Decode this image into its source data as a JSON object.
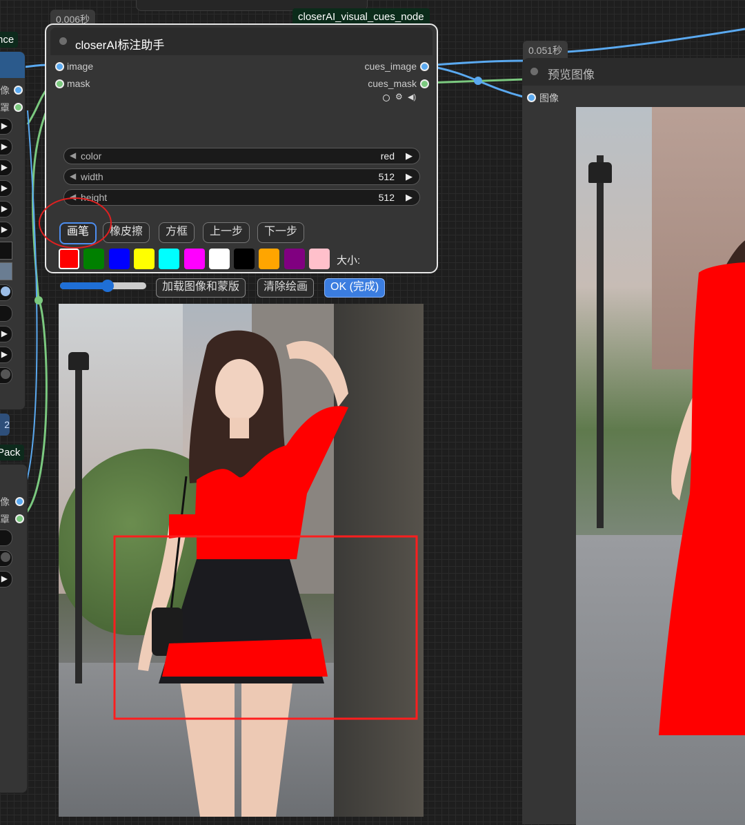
{
  "left_panel": {
    "top_node_title": "nce",
    "top_slots": [
      "像",
      "罩"
    ],
    "bottom_node_title": "Pack",
    "bottom_slots": [
      "像",
      "罩"
    ],
    "badge": "2"
  },
  "main_node": {
    "time": "0.006秒",
    "type_tag": "closerAI_visual_cues_node",
    "title": "closerAI标注助手",
    "inputs": [
      "image",
      "mask"
    ],
    "outputs": [
      "cues_image",
      "cues_mask"
    ],
    "widgets": [
      {
        "label": "color",
        "value": "red"
      },
      {
        "label": "width",
        "value": "512"
      },
      {
        "label": "height",
        "value": "512"
      }
    ],
    "tools": [
      "画笔",
      "橡皮擦",
      "方框",
      "上一步",
      "下一步"
    ],
    "active_tool": "画笔",
    "colors": [
      "#ff0000",
      "#008000",
      "#0000ff",
      "#ffff00",
      "#00ffff",
      "#ff00ff",
      "#ffffff",
      "#000000",
      "#ffa500",
      "#800080",
      "#ffc0cb"
    ],
    "selected_color": "#ff0000",
    "size_label": "大小:"
  },
  "canvas_controls": {
    "slider_value_fraction": 0.55,
    "load_button": "加载图像和蒙版",
    "clear_button": "清除绘画",
    "ok_button": "OK (完成)"
  },
  "preview_node": {
    "time": "0.051秒",
    "title": "预览图像",
    "input": "图像"
  },
  "annotation_color": "#ff0000",
  "wire_colors": {
    "image": "#5aa9f0",
    "mask": "#7bc97f"
  }
}
